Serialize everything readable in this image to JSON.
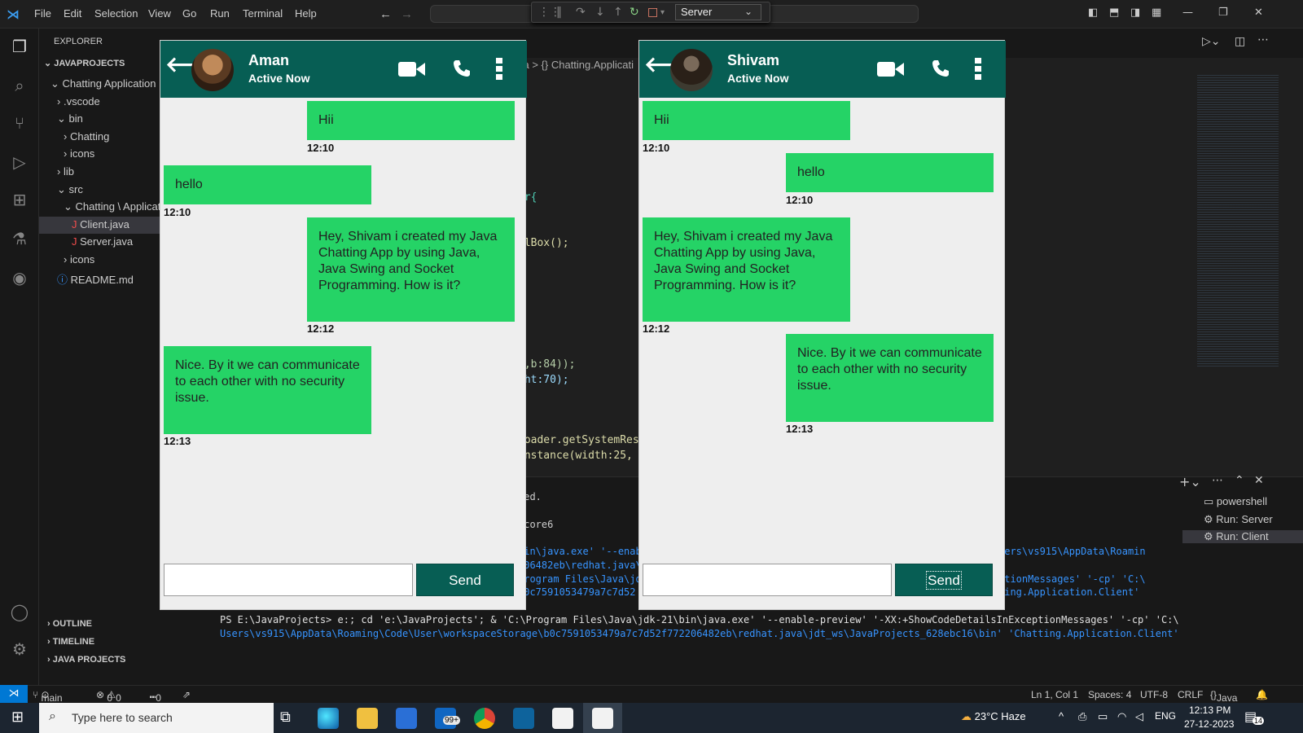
{
  "menu": [
    "File",
    "Edit",
    "Selection",
    "View",
    "Go",
    "Run",
    "Terminal",
    "Help"
  ],
  "debug_config": "Server",
  "explorer": {
    "title": "EXPLORER",
    "root": "JAVAPROJECTS",
    "items": [
      {
        "label": "Chatting Application",
        "depth": 1,
        "arrow": "v"
      },
      {
        "label": ".vscode",
        "depth": 2,
        "arrow": ">"
      },
      {
        "label": "bin",
        "depth": 2,
        "arrow": "v"
      },
      {
        "label": "Chatting",
        "depth": 3,
        "arrow": ">"
      },
      {
        "label": "icons",
        "depth": 3,
        "arrow": ">"
      },
      {
        "label": "lib",
        "depth": 2,
        "arrow": ">"
      },
      {
        "label": "src",
        "depth": 2,
        "arrow": "v"
      },
      {
        "label": "Chatting \\ Application",
        "depth": 3,
        "arrow": "v"
      },
      {
        "label": "Client.java",
        "depth": 4,
        "arrow": "J"
      },
      {
        "label": "Server.java",
        "depth": 4,
        "arrow": "J"
      },
      {
        "label": "icons",
        "depth": 3,
        "arrow": ">"
      },
      {
        "label": "README.md",
        "depth": 2,
        "arrow": "i"
      }
    ],
    "sections": [
      "OUTLINE",
      "TIMELINE",
      "JAVA PROJECTS"
    ]
  },
  "editor": {
    "breadcrumb": "va > {} Chatting.Applicati",
    "code_lines": [
      "er{",
      "alBox();",
      "4,b:84));",
      "ght:70);",
      "Loader.getSystemReso",
      "Instance(width:25, h"
    ],
    "term_fragments": [
      "ved.",
      "score6",
      "bin\\java.exe' '--enabl",
      "206482eb\\redhat.java\\j",
      "Program Files\\Java\\jdk",
      "b0c7591053479a7c7d52"
    ],
    "term_right": [
      "sers\\vs915\\AppData\\Roamin",
      "ptionMessages' '-cp' 'C:\\",
      "ting.Application.Client'"
    ],
    "prompt_line1": "PS E:\\JavaProjects>  e:; cd 'e:\\JavaProjects'; & 'C:\\Program Files\\Java\\jdk-21\\bin\\java.exe' '--enable-preview' '-XX:+ShowCodeDetailsInExceptionMessages' '-cp' 'C:\\",
    "prompt_line2": "Users\\vs915\\AppData\\Roaming\\Code\\User\\workspaceStorage\\b0c7591053479a7c7d52f772206482eb\\redhat.java\\jdt_ws\\JavaProjects_628ebc16\\bin' 'Chatting.Application.Client'"
  },
  "terminals": [
    "powershell",
    "Run: Server",
    "Run: Client"
  ],
  "status": {
    "branch": "main",
    "errors": "0",
    "warnings": "0",
    "ports": "0",
    "position": "Ln 1, Col 1",
    "spaces": "Spaces: 4",
    "encoding": "UTF-8",
    "eol": "CRLF",
    "language": "Java"
  },
  "taskbar": {
    "search_placeholder": "Type here to search",
    "mail_badge": "99+",
    "weather": "23°C  Haze",
    "lang": "ENG",
    "time": "12:13 PM",
    "date": "27-12-2023",
    "notif": "14"
  },
  "client_window": {
    "name": "Aman",
    "status": "Active Now",
    "send": "Send",
    "messages": [
      {
        "text": "Hii",
        "time": "12:10",
        "side": "right"
      },
      {
        "text": "hello",
        "time": "12:10",
        "side": "left"
      },
      {
        "text": "Hey, Shivam i created my Java Chatting App by using Java, Java Swing and Socket Programming. How is it?",
        "time": "12:12",
        "side": "right"
      },
      {
        "text": "Nice. By it we can communicate to each other with no security issue.",
        "time": "12:13",
        "side": "left"
      }
    ]
  },
  "server_window": {
    "name": "Shivam",
    "status": "Active Now",
    "send": "Send",
    "messages": [
      {
        "text": "Hii",
        "time": "12:10",
        "side": "left"
      },
      {
        "text": "hello",
        "time": "12:10",
        "side": "right"
      },
      {
        "text": "Hey, Shivam i created my Java Chatting App by using Java, Java Swing and Socket Programming. How is it?",
        "time": "12:12",
        "side": "left"
      },
      {
        "text": "Nice. By it we can communicate to each other with no security issue.",
        "time": "12:13",
        "side": "right"
      }
    ]
  },
  "colors": {
    "header": "#075e54",
    "bubble": "#25d366",
    "accent": "#0078d4"
  }
}
